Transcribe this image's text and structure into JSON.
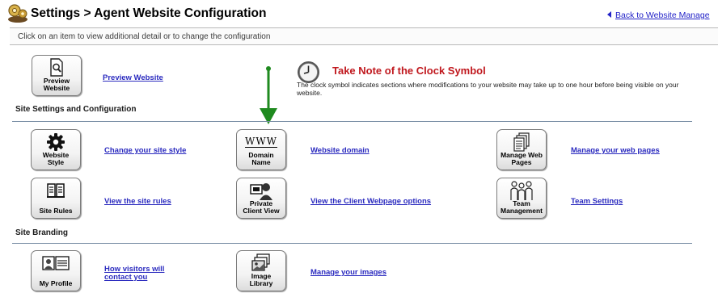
{
  "header": {
    "title": "Settings > Agent Website Configuration",
    "back_link": "Back to Website Manage"
  },
  "instruction": "Click on an item to view additional detail or to change the configuration",
  "preview": {
    "tile_label": "Preview\nWebsite",
    "link": "Preview Website"
  },
  "note": {
    "title": "Take Note of the Clock Symbol",
    "body": "The clock symbol indicates sections where modifications to your website may take up to one hour before being visible on your website."
  },
  "site_settings": {
    "heading": "Site Settings and Configuration",
    "items": [
      {
        "tile_label": "Website\nStyle",
        "link": "Change your site style",
        "icon": "gear-icon"
      },
      {
        "tile_label": "Domain\nName",
        "link": "Website domain",
        "icon": "www-icon",
        "icon_text": "WWW"
      },
      {
        "tile_label": "Manage Web\nPages",
        "link": "Manage your web pages",
        "icon": "pages-icon"
      },
      {
        "tile_label": "Site Rules",
        "link": "View the site rules",
        "icon": "book-icon"
      },
      {
        "tile_label": "Private\nClient View",
        "link": "View the Client Webpage options",
        "icon": "client-view-icon"
      },
      {
        "tile_label": "Team\nManagement",
        "link": "Team Settings",
        "icon": "team-icon"
      }
    ]
  },
  "site_branding": {
    "heading": "Site Branding",
    "items": [
      {
        "tile_label": "My Profile",
        "link": "How visitors will\ncontact you",
        "icon": "profile-card-icon"
      },
      {
        "tile_label": "Image\nLibrary",
        "link": "Manage your images",
        "icon": "image-library-icon"
      }
    ]
  },
  "colors": {
    "link": "#2b2bbf",
    "note_title": "#c0181e",
    "arrow": "#1f8a1f",
    "divider": "#7a8fa6"
  }
}
